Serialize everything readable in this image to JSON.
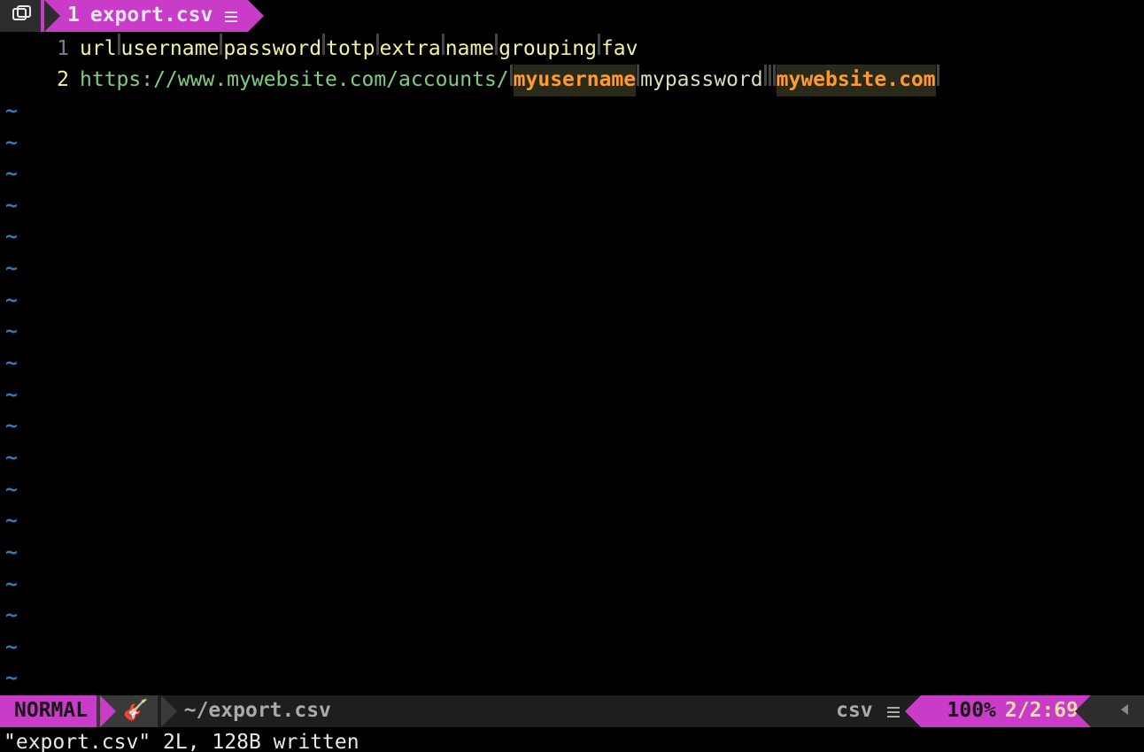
{
  "tab": {
    "index": "1",
    "name": "export.csv",
    "modified_icon": "≡",
    "buffer_icon": "⎘"
  },
  "file": {
    "headers": [
      "url",
      "username",
      "password",
      "totp",
      "extra",
      "name",
      "grouping",
      "fav"
    ],
    "row": {
      "url": "https://www.mywebsite.com/accounts/",
      "username": "myusername",
      "password": "mypassword",
      "totp": "",
      "extra": "",
      "name": "mywebsite.com",
      "grouping": "",
      "fav": ""
    },
    "line1_num": "1",
    "line2_num": "2"
  },
  "tilde": "~",
  "tilde_count": 19,
  "status": {
    "mode": "NORMAL",
    "branch_icon": "🎸",
    "path": "~/export.csv",
    "filetype": "csv",
    "ft_icon": "≡",
    "percent": "100%",
    "location": "2/2:69",
    "end_icon": "◀"
  },
  "message": "\"export.csv\" 2L, 128B written"
}
